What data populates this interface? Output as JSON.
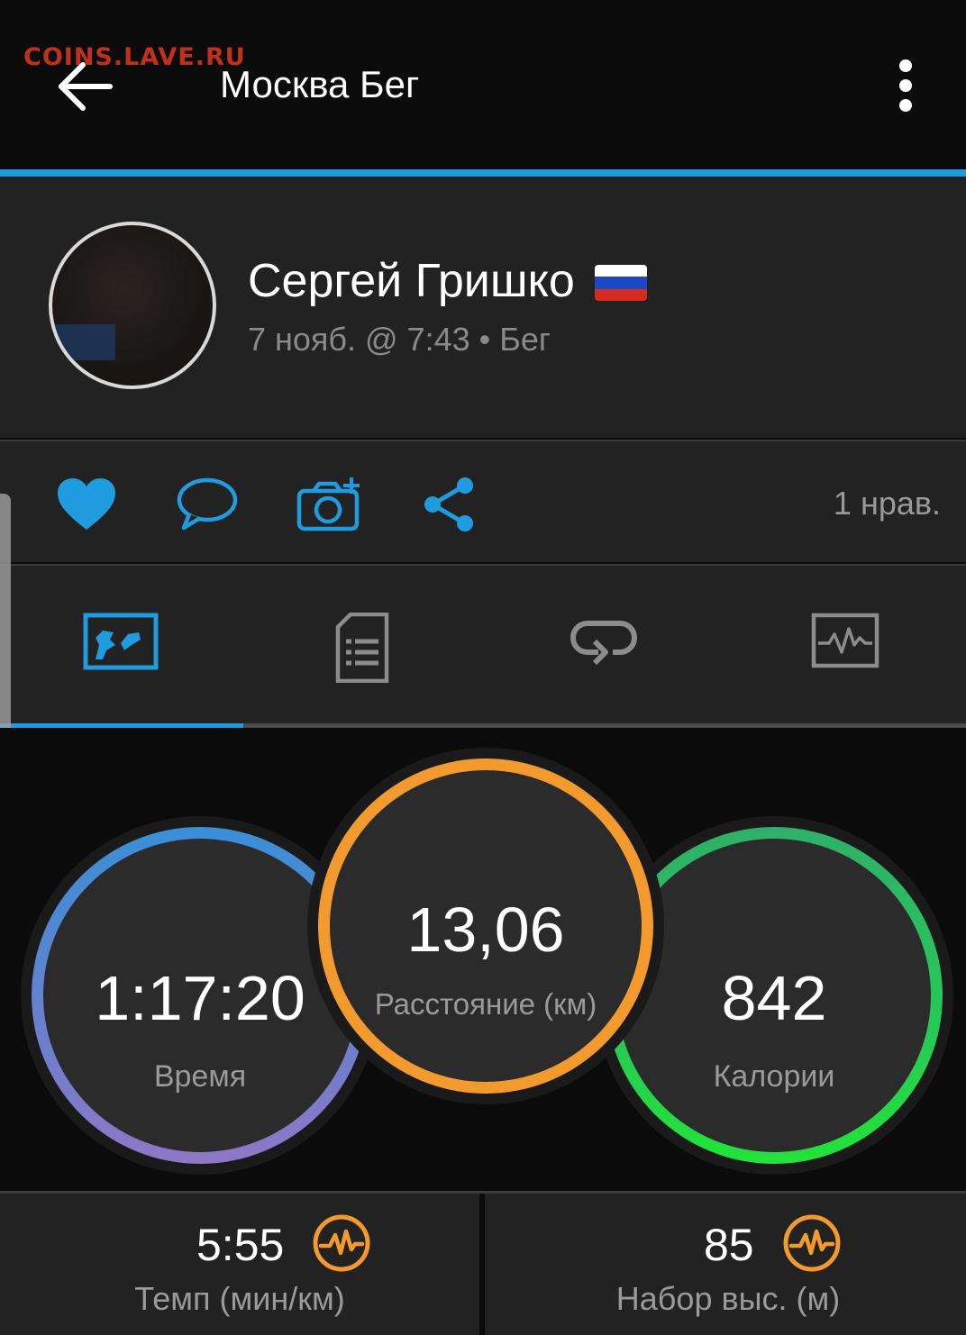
{
  "header": {
    "watermark": "COINS.LAVE.RU",
    "title": "Москва Бег"
  },
  "profile": {
    "name": "Сергей Гришко",
    "meta": "7 нояб. @ 7:43 • Бег",
    "flag_colors": [
      "#ffffff",
      "#1c48c4",
      "#d52b1e"
    ]
  },
  "actions": {
    "likes_count": "1 нрав.",
    "icons": [
      "heart-icon",
      "comment-icon",
      "add-photo-icon",
      "share-icon"
    ]
  },
  "tabs": [
    {
      "id": "map",
      "icon": "map-icon",
      "active": true
    },
    {
      "id": "details",
      "icon": "document-list-icon",
      "active": false
    },
    {
      "id": "laps",
      "icon": "loop-icon",
      "active": false
    },
    {
      "id": "graphs",
      "icon": "activity-graph-icon",
      "active": false
    }
  ],
  "stats": {
    "time": {
      "value": "1:17:20",
      "label": "Время"
    },
    "distance": {
      "value": "13,06",
      "label": "Расстояние (км)"
    },
    "calories": {
      "value": "842",
      "label": "Калории"
    }
  },
  "metrics": {
    "pace": {
      "value": "5:55",
      "label": "Темп (мин/км)"
    },
    "elevation": {
      "value": "85",
      "label": "Набор выс. (м)"
    }
  },
  "colors": {
    "accent": "#1f9be0",
    "distance_ring": "#f29a2e",
    "metric_icon": "#f29a2e"
  }
}
